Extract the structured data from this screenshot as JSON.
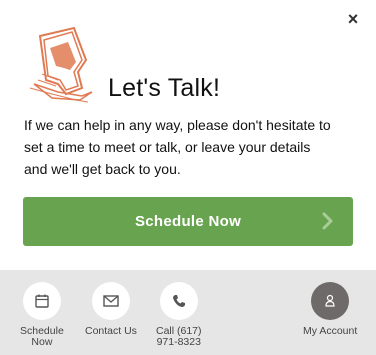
{
  "popup": {
    "close_label": "×",
    "title": "Let's Talk!",
    "body_lines": [
      "If we can help in any way, please don't hesitate to",
      "set a time to meet or talk, or leave your details",
      "and we'll get back to you."
    ],
    "cta_label": "Schedule Now"
  },
  "footer": {
    "items": [
      {
        "label_lines": [
          "Schedule",
          "Now"
        ],
        "icon": "calendar-icon"
      },
      {
        "label_lines": [
          "Contact Us"
        ],
        "icon": "envelope-icon"
      },
      {
        "label_lines": [
          "Call (617)",
          "971-8323"
        ],
        "icon": "phone-icon"
      },
      {
        "label_lines": [
          "My Account"
        ],
        "icon": "user-icon"
      }
    ]
  },
  "colors": {
    "accent": "#68a44f",
    "logo": "#e07a52",
    "footer_bg": "#e6e6e6",
    "account_circle": "#6e6a69"
  }
}
